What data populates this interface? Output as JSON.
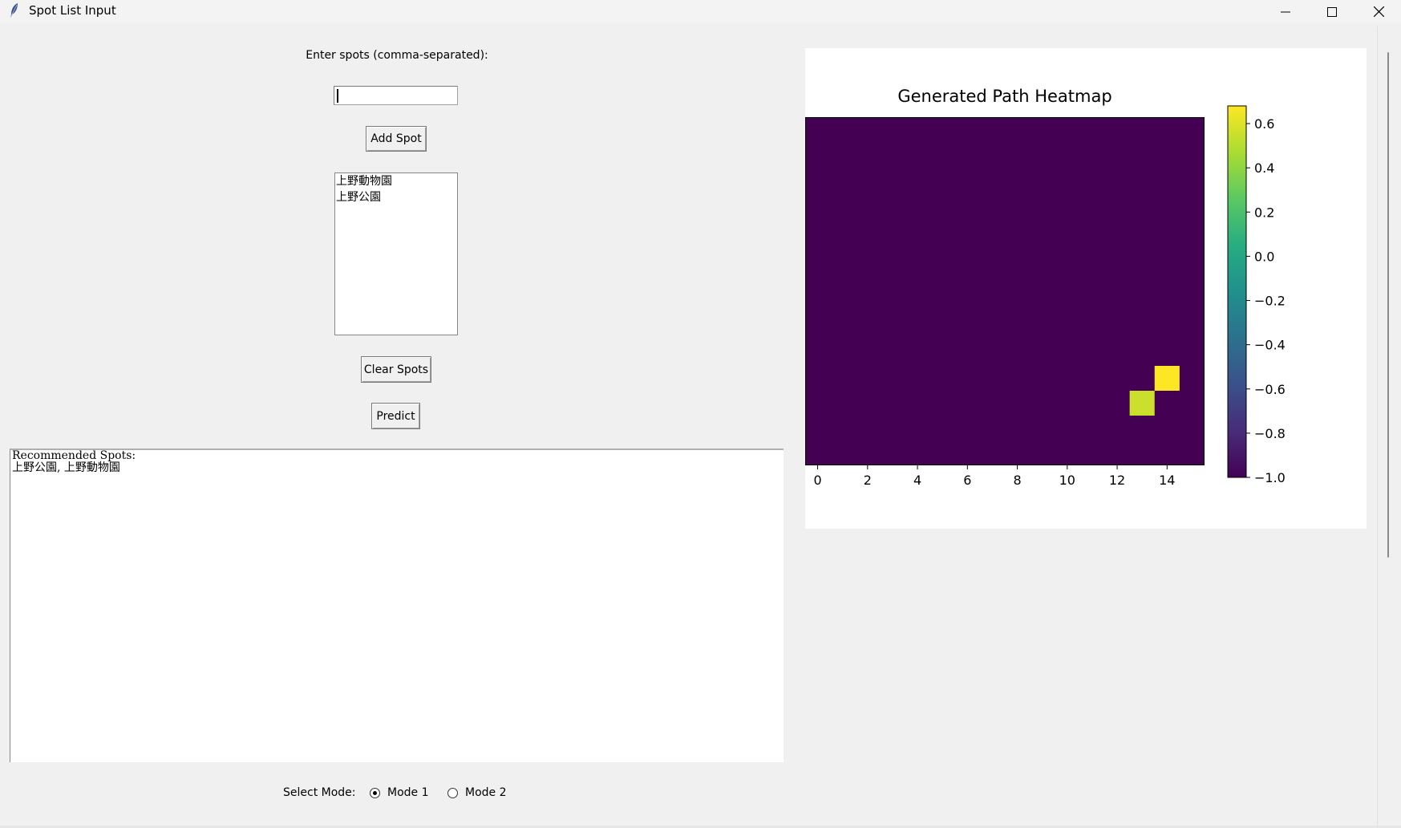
{
  "window": {
    "title": "Spot List Input"
  },
  "input_label": "Enter spots (comma-separated):",
  "spot_input": {
    "value": ""
  },
  "buttons": {
    "add": "Add Spot",
    "clear": "Clear Spots",
    "predict": "Predict"
  },
  "spot_list": [
    "上野動物園",
    "上野公園"
  ],
  "result": {
    "line1": "Recommended Spots:",
    "line2": "上野公園, 上野動物園"
  },
  "mode": {
    "label": "Select Mode:",
    "options": [
      "Mode 1",
      "Mode 2"
    ],
    "selected": "Mode 1"
  },
  "chart_data": {
    "type": "heatmap",
    "title": "Generated Path Heatmap",
    "colormap": "viridis",
    "rows": 14,
    "cols": 16,
    "base_value": -1.0,
    "highlighted_cells": [
      {
        "row": 10,
        "col": 14,
        "value": 0.68
      },
      {
        "row": 11,
        "col": 13,
        "value": 0.55
      }
    ],
    "xticks": [
      "0",
      "2",
      "4",
      "6",
      "8",
      "10",
      "12",
      "14"
    ],
    "yticks": [],
    "colorbar": {
      "range": [
        -1.0,
        0.68
      ],
      "ticks": [
        "0.6",
        "0.4",
        "0.2",
        "0.0",
        "−0.2",
        "−0.4",
        "−0.6",
        "−0.8",
        "−1.0"
      ],
      "tick_values": [
        0.6,
        0.4,
        0.2,
        0.0,
        -0.2,
        -0.4,
        -0.6,
        -0.8,
        -1.0
      ]
    },
    "grid": false
  }
}
